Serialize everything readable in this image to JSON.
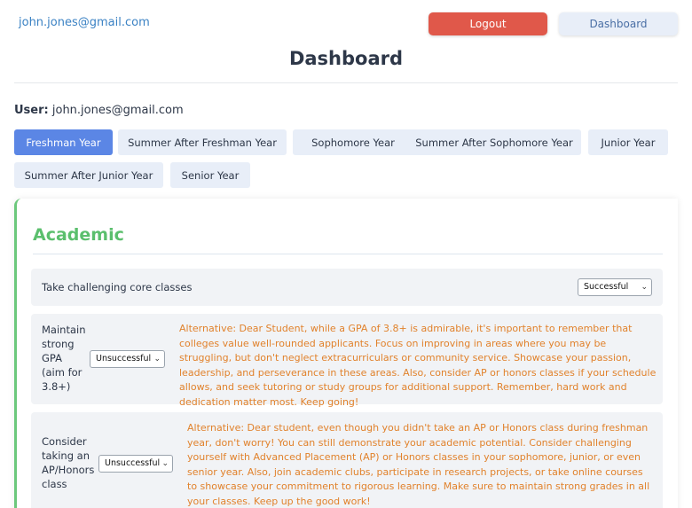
{
  "header": {
    "email": "john.jones@gmail.com",
    "logout_label": "Logout",
    "dashboard_label": "Dashboard"
  },
  "page": {
    "title": "Dashboard",
    "user_label": "User:",
    "user_value": "john.jones@gmail.com"
  },
  "tabs": [
    {
      "label": "Freshman Year",
      "active": true
    },
    {
      "label": "Summer After Freshman Year",
      "active": false
    },
    {
      "label": "Sophomore Year",
      "active": false
    },
    {
      "label": "Summer After Sophomore Year",
      "active": false
    },
    {
      "label": "Junior Year",
      "active": false
    },
    {
      "label": "Summer After Junior Year",
      "active": false
    },
    {
      "label": "Senior Year",
      "active": false
    }
  ],
  "section": {
    "title": "Academic",
    "goals": [
      {
        "text": "Take challenging core classes",
        "status": "Successful",
        "alternative": ""
      },
      {
        "text": "Maintain strong GPA (aim for 3.8+)",
        "status": "Unsuccessful",
        "alternative": "Alternative: Dear Student, while a GPA of 3.8+ is admirable, it's important to remember that colleges value well-rounded applicants. Focus on improving in areas where you may be struggling, but don't neglect extracurriculars or community service. Showcase your passion, leadership, and perseverance in these areas. Also, consider AP or honors classes if your schedule allows, and seek tutoring or study groups for additional support. Remember, hard work and dedication matter most. Keep going!"
      },
      {
        "text": "Consider taking an AP/Honors class",
        "status": "Unsuccessful",
        "alternative": "Alternative: Dear student, even though you didn't take an AP or Honors class during freshman year, don't worry! You can still demonstrate your academic potential. Consider challenging yourself with Advanced Placement (AP) or Honors classes in your sophomore, junior, or even senior year. Also, join academic clubs, participate in research projects, or take online courses to showcase your commitment to rigorous learning. Make sure to maintain strong grades in all your classes. Keep up the good work!"
      }
    ]
  },
  "colors": {
    "logout": "#e0584a",
    "tab_active": "#5b86e5",
    "section_accent": "#5bbf6d",
    "alternative_text": "#e1822c"
  }
}
